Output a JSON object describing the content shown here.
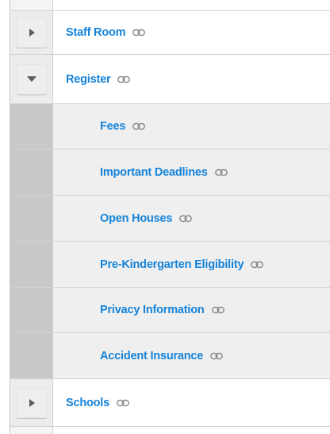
{
  "tree": {
    "items": [
      {
        "label": "Staff Room",
        "state": "collapsed"
      },
      {
        "label": "Register",
        "state": "expanded",
        "children": [
          {
            "label": "Fees"
          },
          {
            "label": "Important Deadlines"
          },
          {
            "label": "Open Houses"
          },
          {
            "label": "Pre-Kindergarten Eligibility"
          },
          {
            "label": "Privacy Information"
          },
          {
            "label": "Accident Insurance"
          }
        ]
      },
      {
        "label": "Schools",
        "state": "collapsed"
      }
    ]
  },
  "icons": {
    "toggle_collapsed": "triangle-right-icon",
    "toggle_expanded": "triangle-down-icon",
    "link": "chain-link-icon"
  },
  "colors": {
    "link_text": "#1583d9",
    "child_bg": "#efefef",
    "gutter_bg": "#c9c9c9",
    "toggle_bg": "#ececec"
  }
}
